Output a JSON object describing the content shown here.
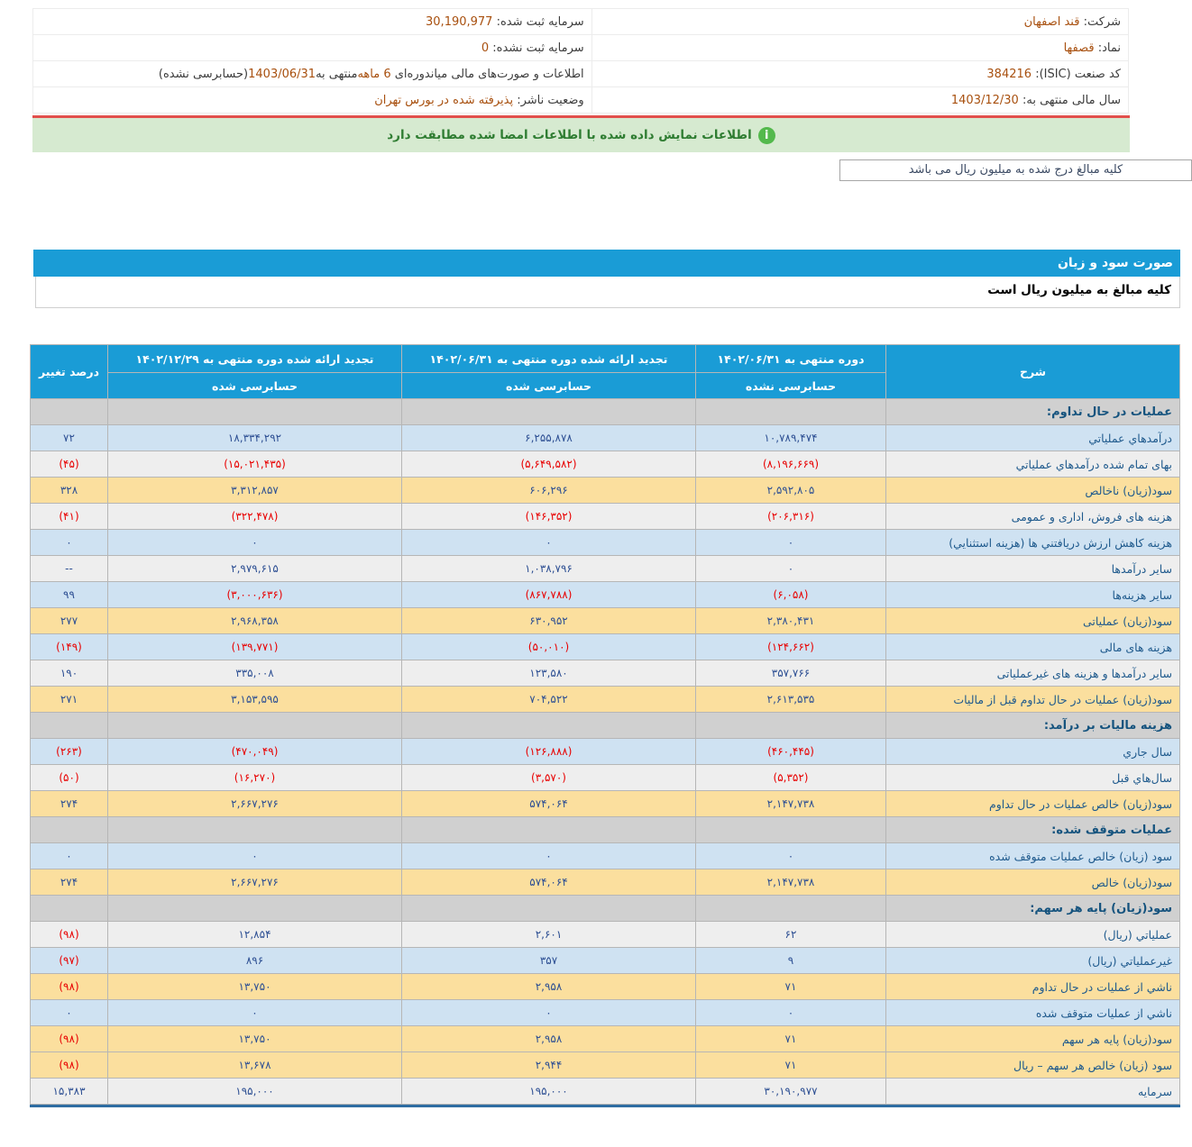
{
  "info": {
    "company_label": "شرکت:",
    "company_value": "قند اصفهان",
    "symbol_label": "نماد:",
    "symbol_value": "قصفها",
    "isic_label": "کد صنعت (ISIC):",
    "isic_value": "384216",
    "fiscal_label": "سال مالی منتهی به:",
    "fiscal_value": "1403/12/30",
    "reg_capital_label": "سرمایه ثبت شده:",
    "reg_capital_value": "30,190,977",
    "unreg_capital_label": "سرمایه ثبت نشده:",
    "unreg_capital_value": "0",
    "report": {
      "p1": "اطلاعات و صورت‌های مالی میاندوره‌ای ",
      "p2": "6 ماهه‌",
      "p3": "منتهی به",
      "p4": "1403/06/31",
      "p5": "(حسابرسی نشده)"
    },
    "status_label": "وضعیت ناشر:",
    "status_value": "پذیرفته شده در بورس تهران"
  },
  "banner": {
    "icon": "info-icon",
    "icon_glyph": "i",
    "text": "اطلاعات نمایش داده شده با اطلاعات امضا شده مطابقت دارد"
  },
  "amount_note": "کلیه مبالغ درج شده به میلیون ریال می باشد",
  "section_title": "صورت سود و زیان",
  "units_note": "کلیه مبالغ به میلیون ریال است",
  "colors": {
    "header_blue": "#1a9cd6",
    "row_blue": "#cfe2f2",
    "row_yellow": "#fbdf9e",
    "row_section_gray": "#d0d0d0",
    "row_plain": "#eeeeee",
    "negative_red": "#e80000",
    "value_navy": "#2d4f93",
    "banner_green_bg": "#d6ead0",
    "icon_green": "#53b94c",
    "red_line": "#e2504c",
    "bottom_border_blue": "#2d6ca2",
    "info_value_brown": "#a8500f"
  },
  "statement": {
    "header": {
      "desc": "شرح",
      "p1_title": "دوره منتهی به ۱۴۰۲/۰۶/۳۱",
      "p1_sub": "حسابرسی نشده",
      "p2_title": "تجدید ارائه شده دوره منتهی به ۱۴۰۲/۰۶/۳۱",
      "p2_sub": "حسابرسی شده",
      "p3_title": "تجدید ارائه شده دوره منتهی به ۱۴۰۲/۱۲/۲۹",
      "p3_sub": "حسابرسی شده",
      "change": "درصد تغییر"
    },
    "rows": [
      {
        "type": "section",
        "label": "عملیات در حال تداوم:"
      },
      {
        "type": "data",
        "bg": "blue",
        "label": "درآمدهاي عملياتي",
        "values": [
          "۱۰,۷۸۹,۴۷۴",
          "۶,۲۵۵,۸۷۸",
          "۱۸,۳۳۴,۲۹۲",
          "۷۲"
        ]
      },
      {
        "type": "data",
        "bg": "plain",
        "label": "بهای تمام شده درآمدهاي عملياتي",
        "values": [
          "(۸,۱۹۶,۶۶۹)",
          "(۵,۶۴۹,۵۸۲)",
          "(۱۵,۰۲۱,۴۳۵)",
          "(۴۵)"
        ]
      },
      {
        "type": "data",
        "bg": "yellow",
        "label": "سود(زیان) ناخالص",
        "values": [
          "۲,۵۹۲,۸۰۵",
          "۶۰۶,۲۹۶",
          "۳,۳۱۲,۸۵۷",
          "۳۲۸"
        ]
      },
      {
        "type": "data",
        "bg": "plain",
        "label": "هزینه های فروش، اداری و عمومی",
        "values": [
          "(۲۰۶,۳۱۶)",
          "(۱۴۶,۳۵۲)",
          "(۳۲۲,۴۷۸)",
          "(۴۱)"
        ]
      },
      {
        "type": "data",
        "bg": "blue",
        "label": "هزینه کاهش ارزش دریافتني ها (هزینه استثنایي)",
        "values": [
          "۰",
          "۰",
          "۰",
          "۰"
        ]
      },
      {
        "type": "data",
        "bg": "plain",
        "label": "سایر درآمدها",
        "values": [
          "۰",
          "۱,۰۳۸,۷۹۶",
          "۲,۹۷۹,۶۱۵",
          "--"
        ]
      },
      {
        "type": "data",
        "bg": "blue",
        "label": "سایر هزینه‌ها",
        "values": [
          "(۶,۰۵۸)",
          "(۸۶۷,۷۸۸)",
          "(۳,۰۰۰,۶۳۶)",
          "۹۹"
        ]
      },
      {
        "type": "data",
        "bg": "yellow",
        "label": "سود(زیان) عملیاتی",
        "values": [
          "۲,۳۸۰,۴۳۱",
          "۶۳۰,۹۵۲",
          "۲,۹۶۸,۳۵۸",
          "۲۷۷"
        ]
      },
      {
        "type": "data",
        "bg": "blue",
        "label": "هزینه های مالی",
        "values": [
          "(۱۲۴,۶۶۲)",
          "(۵۰,۰۱۰)",
          "(۱۳۹,۷۷۱)",
          "(۱۴۹)"
        ]
      },
      {
        "type": "data",
        "bg": "plain",
        "label": "سایر درآمدها و هزینه های غیرعملیاتی",
        "values": [
          "۳۵۷,۷۶۶",
          "۱۲۳,۵۸۰",
          "۳۳۵,۰۰۸",
          "۱۹۰"
        ]
      },
      {
        "type": "data",
        "bg": "yellow",
        "label": "سود(زیان) عملیات در حال تداوم قبل از مالیات",
        "values": [
          "۲,۶۱۳,۵۳۵",
          "۷۰۴,۵۲۲",
          "۳,۱۵۳,۵۹۵",
          "۲۷۱"
        ]
      },
      {
        "type": "section",
        "label": "هزینه مالیات بر درآمد:"
      },
      {
        "type": "data",
        "bg": "blue",
        "label": "سال جاري",
        "values": [
          "(۴۶۰,۴۴۵)",
          "(۱۲۶,۸۸۸)",
          "(۴۷۰,۰۴۹)",
          "(۲۶۳)"
        ]
      },
      {
        "type": "data",
        "bg": "plain",
        "label": "سال‌هاي قبل",
        "values": [
          "(۵,۳۵۲)",
          "(۳,۵۷۰)",
          "(۱۶,۲۷۰)",
          "(۵۰)"
        ]
      },
      {
        "type": "data",
        "bg": "yellow",
        "label": "سود(زیان) خالص عملیات در حال تداوم",
        "values": [
          "۲,۱۴۷,۷۳۸",
          "۵۷۴,۰۶۴",
          "۲,۶۶۷,۲۷۶",
          "۲۷۴"
        ]
      },
      {
        "type": "section",
        "label": "عملیات متوقف شده:"
      },
      {
        "type": "data",
        "bg": "blue",
        "label": "سود (زیان) خالص عملیات متوقف شده",
        "values": [
          "۰",
          "۰",
          "۰",
          "۰"
        ]
      },
      {
        "type": "data",
        "bg": "yellow",
        "label": "سود(زیان) خالص",
        "values": [
          "۲,۱۴۷,۷۳۸",
          "۵۷۴,۰۶۴",
          "۲,۶۶۷,۲۷۶",
          "۲۷۴"
        ]
      },
      {
        "type": "section",
        "label": "سود(زیان) پایه هر سهم:"
      },
      {
        "type": "data",
        "bg": "plain",
        "label": "عملیاتي (ریال)",
        "values": [
          "۶۲",
          "۲,۶۰۱",
          "۱۲,۸۵۴",
          "(۹۸)"
        ]
      },
      {
        "type": "data",
        "bg": "blue",
        "label": "غیرعملیاتي (ریال)",
        "values": [
          "۹",
          "۳۵۷",
          "۸۹۶",
          "(۹۷)"
        ]
      },
      {
        "type": "data",
        "bg": "yellow",
        "label": "ناشي از عملیات در حال تداوم",
        "values": [
          "۷۱",
          "۲,۹۵۸",
          "۱۳,۷۵۰",
          "(۹۸)"
        ]
      },
      {
        "type": "data",
        "bg": "blue",
        "label": "ناشي از عملیات متوقف شده",
        "values": [
          "۰",
          "۰",
          "۰",
          "۰"
        ]
      },
      {
        "type": "data",
        "bg": "yellow",
        "label": "سود(زیان) پایه هر سهم",
        "values": [
          "۷۱",
          "۲,۹۵۸",
          "۱۳,۷۵۰",
          "(۹۸)"
        ]
      },
      {
        "type": "data",
        "bg": "yellow",
        "label": "سود (زیان) خالص هر سهم – ریال",
        "values": [
          "۷۱",
          "۲,۹۴۴",
          "۱۳,۶۷۸",
          "(۹۸)"
        ]
      },
      {
        "type": "data",
        "bg": "plain",
        "label": "سرمایه",
        "values": [
          "۳۰,۱۹۰,۹۷۷",
          "۱۹۵,۰۰۰",
          "۱۹۵,۰۰۰",
          "۱۵,۳۸۳"
        ]
      }
    ]
  }
}
